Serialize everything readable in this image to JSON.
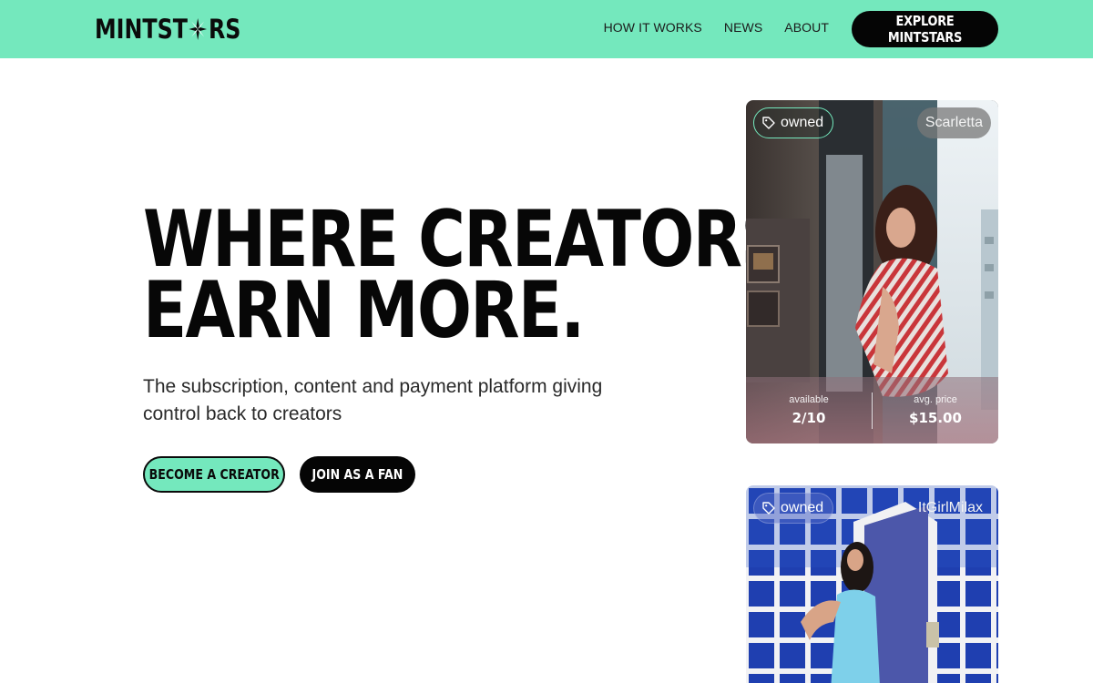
{
  "header": {
    "logo_text_a": "MINTST",
    "logo_text_b": "RS",
    "nav": [
      "HOW IT WORKS",
      "NEWS",
      "ABOUT"
    ],
    "cta_label": "EXPLORE MINTSTARS"
  },
  "hero": {
    "title_line1": "WHERE CREATORS",
    "title_line2": "EARN MORE.",
    "subtitle": "The subscription, content and payment platform giving control back to creators",
    "btn_creator": "BECOME A CREATOR",
    "btn_fan": "JOIN AS A FAN"
  },
  "cards": [
    {
      "badge": "owned",
      "creator": "Scarletta",
      "available_label": "available",
      "available_value": "2/10",
      "price_label": "avg. price",
      "price_value": "$15.00"
    },
    {
      "badge": "owned",
      "creator": "ItGirlMilax"
    }
  ],
  "colors": {
    "accent": "#74e8bd",
    "dark": "#050505"
  },
  "icons": {
    "logo_star": "star-icon",
    "badge": "tag-icon"
  }
}
